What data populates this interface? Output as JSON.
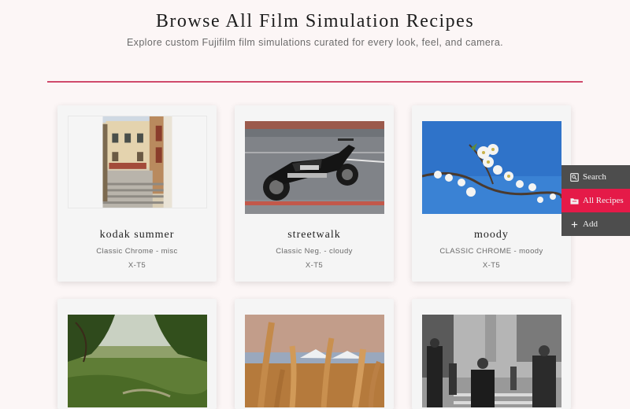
{
  "header": {
    "title": "Browse All Film Simulation Recipes",
    "subtitle": "Explore custom Fujifilm film simulations curated for every look, feel, and camera."
  },
  "nav": {
    "items": [
      {
        "label": "Search",
        "icon": "search-icon"
      },
      {
        "label": "All Recipes",
        "icon": "folder-icon",
        "active": true
      },
      {
        "label": "Add",
        "icon": "plus-icon"
      }
    ]
  },
  "recipes": [
    {
      "title": "kodak summer",
      "meta": "Classic Chrome - misc",
      "camera": "X-T5",
      "photo": "european street steps"
    },
    {
      "title": "streetwalk",
      "meta": "Classic Neg. - cloudy",
      "camera": "X-T5",
      "photo": "black motorcycle"
    },
    {
      "title": "moody",
      "meta": "CLASSIC CHROME - moody",
      "camera": "X-T5",
      "photo": "white blossoms blue sky"
    },
    {
      "title": "",
      "meta": "",
      "camera": "",
      "photo": "green countryside"
    },
    {
      "title": "",
      "meta": "",
      "camera": "",
      "photo": "dry grass mountains"
    },
    {
      "title": "",
      "meta": "",
      "camera": "",
      "photo": "black and white city crowd"
    }
  ],
  "colors": {
    "accent": "#e51a48",
    "divider": "#d04a6c",
    "nav_bg": "#4d4d4d",
    "background": "#fcf6f6"
  }
}
